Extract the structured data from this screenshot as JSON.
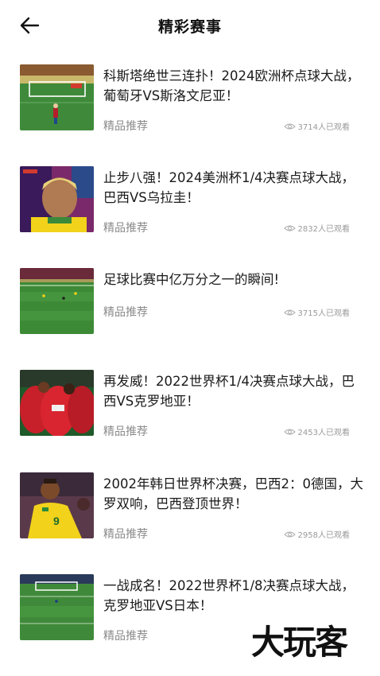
{
  "header": {
    "title": "精彩赛事"
  },
  "items": [
    {
      "title": "科斯塔绝世三连扑！2024欧洲杯点球大战，葡萄牙VS斯洛文尼亚！",
      "tag": "精品推荐",
      "views": "3714人已观看",
      "thumb_icon": "penalty-kick-thumb"
    },
    {
      "title": "止步八强！2024美洲杯1/4决赛点球大战，巴西VS乌拉圭！",
      "tag": "精品推荐",
      "views": "2832人已观看",
      "thumb_icon": "player-portrait-thumb"
    },
    {
      "title": "足球比赛中亿万分之一的瞬间!",
      "tag": "精品推荐",
      "views": "3715人已观看",
      "thumb_icon": "pitch-overview-thumb"
    },
    {
      "title": "再发威！2022世界杯1/4决赛点球大战，巴西VS克罗地亚！",
      "tag": "精品推荐",
      "views": "2453人已观看",
      "thumb_icon": "team-huddle-thumb"
    },
    {
      "title": "2002年韩日世界杯决赛，巴西2：0德国，大罗双响，巴西登顶世界！",
      "tag": "精品推荐",
      "views": "2958人已观看",
      "thumb_icon": "player-celebration-thumb"
    },
    {
      "title": "一战成名！2022世界杯1/8决赛点球大战，克罗地亚VS日本！",
      "tag": "精品推荐",
      "views": "",
      "thumb_icon": "goal-view-thumb"
    }
  ],
  "watermark": {
    "text": "大玩客"
  },
  "colors": {
    "pitch": "#3f8a3a",
    "brazil_yellow": "#f2d21b",
    "croatia_red": "#c8202a",
    "text_grey": "#8a8a8a"
  }
}
